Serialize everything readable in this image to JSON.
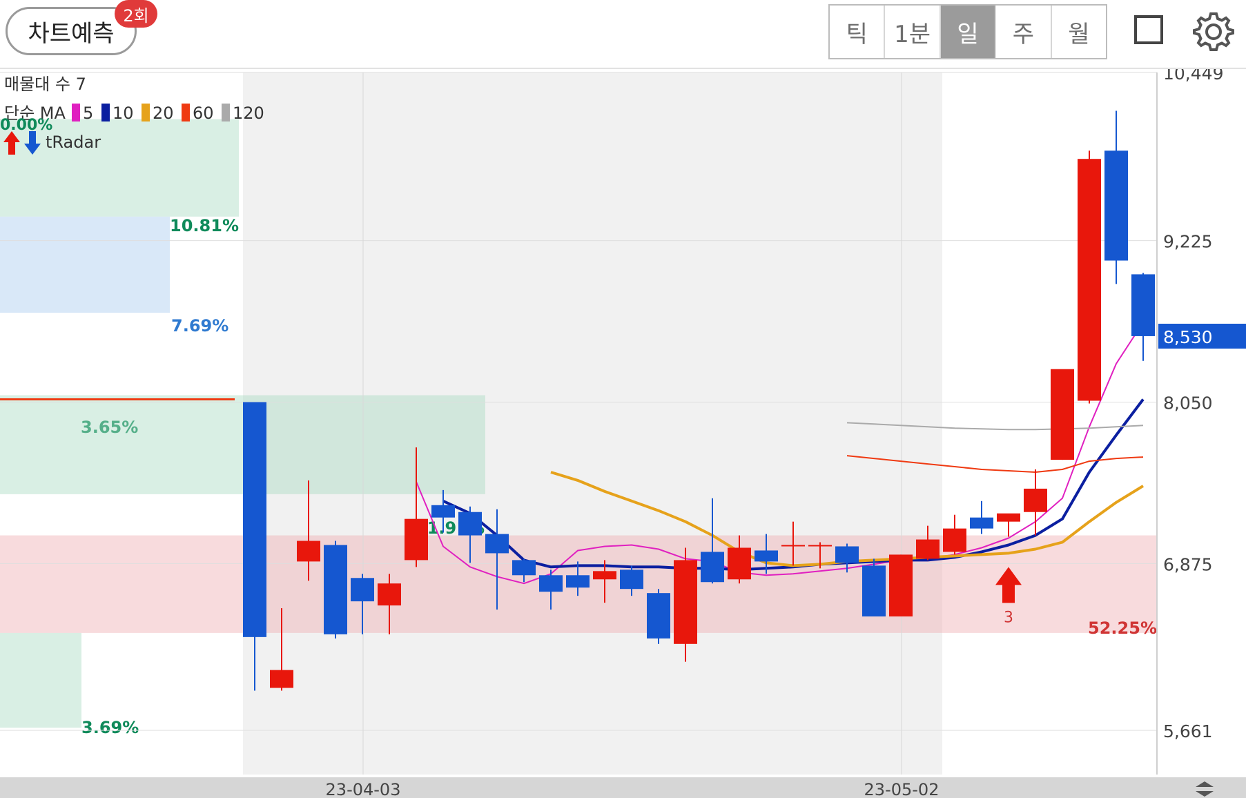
{
  "header": {
    "predict_label": "차트예측",
    "predict_badge": "2회",
    "periods": [
      "틱",
      "1분",
      "일",
      "주",
      "월"
    ],
    "active_period": "일"
  },
  "icons": {
    "layout": "square-icon",
    "settings": "gear-icon"
  },
  "colors": {
    "up": "#e8170c",
    "down": "#1557d0",
    "ma5": "#e020c0",
    "ma10": "#0b1fa0",
    "ma20": "#e6a21b",
    "ma60": "#ef3a12",
    "ma120": "#aaaaaa",
    "current_price_bg": "#1557d0"
  },
  "chart_data": {
    "type": "candlestick",
    "legend": {
      "volume_profile_title": "매물대 수 7",
      "ma_title": "단순 MA",
      "ma_periods": [
        "5",
        "10",
        "20",
        "60",
        "120"
      ],
      "pct_label": "0.00%",
      "radar_label": "tRadar"
    },
    "y_axis": {
      "ticks": [
        "10,449",
        "9,225",
        "8,050",
        "6,875",
        "5,661"
      ],
      "min": 5661,
      "max": 10449
    },
    "x_axis": {
      "ticks": [
        "23-04-03",
        "23-05-02"
      ]
    },
    "current_price": {
      "value": 8530,
      "label": "8,530"
    },
    "candles": [
      {
        "o": 8050,
        "h": 8050,
        "l": 5950,
        "c": 6340
      },
      {
        "o": 5970,
        "h": 6550,
        "l": 5950,
        "c": 6100
      },
      {
        "o": 6890,
        "h": 7480,
        "l": 6750,
        "c": 7040
      },
      {
        "o": 7010,
        "h": 7040,
        "l": 6330,
        "c": 6360
      },
      {
        "o": 6770,
        "h": 6800,
        "l": 6360,
        "c": 6600
      },
      {
        "o": 6570,
        "h": 6800,
        "l": 6360,
        "c": 6730
      },
      {
        "o": 6900,
        "h": 7720,
        "l": 6850,
        "c": 7200
      },
      {
        "o": 7300,
        "h": 7410,
        "l": 7100,
        "c": 7210
      },
      {
        "o": 7250,
        "h": 7290,
        "l": 6880,
        "c": 7080
      },
      {
        "o": 7090,
        "h": 7270,
        "l": 6540,
        "c": 6950
      },
      {
        "o": 6900,
        "h": 6910,
        "l": 6740,
        "c": 6790
      },
      {
        "o": 6790,
        "h": 6830,
        "l": 6540,
        "c": 6670
      },
      {
        "o": 6790,
        "h": 6890,
        "l": 6640,
        "c": 6700
      },
      {
        "o": 6760,
        "h": 6900,
        "l": 6590,
        "c": 6820
      },
      {
        "o": 6830,
        "h": 6860,
        "l": 6640,
        "c": 6690
      },
      {
        "o": 6660,
        "h": 6690,
        "l": 6290,
        "c": 6330
      },
      {
        "o": 6290,
        "h": 6990,
        "l": 6160,
        "c": 6900
      },
      {
        "o": 6960,
        "h": 7350,
        "l": 6730,
        "c": 6740
      },
      {
        "o": 6760,
        "h": 7080,
        "l": 6730,
        "c": 6990
      },
      {
        "o": 6970,
        "h": 7090,
        "l": 6800,
        "c": 6890
      },
      {
        "o": 7000,
        "h": 7180,
        "l": 6860,
        "c": 7010
      },
      {
        "o": 7010,
        "h": 7030,
        "l": 6840,
        "c": 7010
      },
      {
        "o": 7000,
        "h": 7020,
        "l": 6810,
        "c": 6880
      },
      {
        "o": 6860,
        "h": 6910,
        "l": 6490,
        "c": 6490
      },
      {
        "o": 6490,
        "h": 6940,
        "l": 6490,
        "c": 6940
      },
      {
        "o": 6910,
        "h": 7150,
        "l": 6900,
        "c": 7050
      },
      {
        "o": 6960,
        "h": 7230,
        "l": 6940,
        "c": 7130
      },
      {
        "o": 7210,
        "h": 7330,
        "l": 7090,
        "c": 7130
      },
      {
        "o": 7180,
        "h": 7230,
        "l": 7070,
        "c": 7240
      },
      {
        "o": 7250,
        "h": 7560,
        "l": 7080,
        "c": 7420
      },
      {
        "o": 7630,
        "h": 8240,
        "l": 7630,
        "c": 8290
      },
      {
        "o": 8060,
        "h": 9880,
        "l": 8040,
        "c": 9820
      },
      {
        "o": 9880,
        "h": 10170,
        "l": 8910,
        "c": 9080
      },
      {
        "o": 8980,
        "h": 8990,
        "l": 8350,
        "c": 8530
      }
    ],
    "ma_series": [
      {
        "name": "5",
        "values": [
          null,
          null,
          null,
          null,
          null,
          null,
          7470,
          7000,
          6850,
          6780,
          6730,
          6800,
          6970,
          7000,
          7010,
          6980,
          6910,
          6890,
          6810,
          6790,
          6800,
          6820,
          6840,
          6870,
          6900,
          6910,
          6940,
          6990,
          7060,
          7180,
          7350,
          7870,
          8330,
          8630
        ]
      },
      {
        "name": "10",
        "values": [
          null,
          null,
          null,
          null,
          null,
          null,
          null,
          7330,
          7240,
          7080,
          6900,
          6850,
          6860,
          6860,
          6850,
          6850,
          6840,
          6840,
          6830,
          6840,
          6850,
          6870,
          6880,
          6890,
          6900,
          6900,
          6920,
          6960,
          7010,
          7080,
          7200,
          7540,
          7810,
          8070
        ]
      },
      {
        "name": "20",
        "values": [
          null,
          null,
          null,
          null,
          null,
          null,
          null,
          null,
          null,
          null,
          null,
          7540,
          7480,
          7400,
          7330,
          7260,
          7180,
          7080,
          6960,
          6880,
          6860,
          6870,
          6890,
          6900,
          6910,
          6920,
          6930,
          6940,
          6950,
          6980,
          7030,
          7180,
          7320,
          7440
        ]
      },
      {
        "name": "60",
        "values": [
          null,
          null,
          null,
          null,
          null,
          null,
          null,
          null,
          null,
          null,
          null,
          null,
          null,
          null,
          null,
          null,
          null,
          null,
          null,
          null,
          null,
          null,
          7660,
          7640,
          7620,
          7600,
          7580,
          7560,
          7550,
          7540,
          7560,
          7620,
          7640,
          7650
        ]
      },
      {
        "name": "120",
        "values": [
          null,
          null,
          null,
          null,
          null,
          null,
          null,
          null,
          null,
          null,
          null,
          null,
          null,
          null,
          null,
          null,
          null,
          null,
          null,
          null,
          null,
          null,
          7900,
          7890,
          7880,
          7870,
          7860,
          7855,
          7850,
          7850,
          7855,
          7860,
          7870,
          7880
        ]
      }
    ],
    "volume_profile": [
      {
        "low": 9400,
        "high": 10110,
        "percent": "10.81%",
        "color": "green"
      },
      {
        "low": 8700,
        "high": 9400,
        "percent": "7.69%",
        "color": "blue"
      },
      {
        "low": 7380,
        "high": 8100,
        "percent": "3.65%",
        "color": "green"
      },
      {
        "low": 7380,
        "high": 8100,
        "percent": "21.91%",
        "color": "green"
      },
      {
        "low": 6370,
        "high": 7080,
        "percent": "52.25%",
        "color": "red"
      },
      {
        "low": 5680,
        "high": 6370,
        "percent": "3.69%",
        "color": "green"
      }
    ],
    "signals": [
      {
        "index": 28,
        "type": "buy",
        "label": "3"
      }
    ]
  }
}
